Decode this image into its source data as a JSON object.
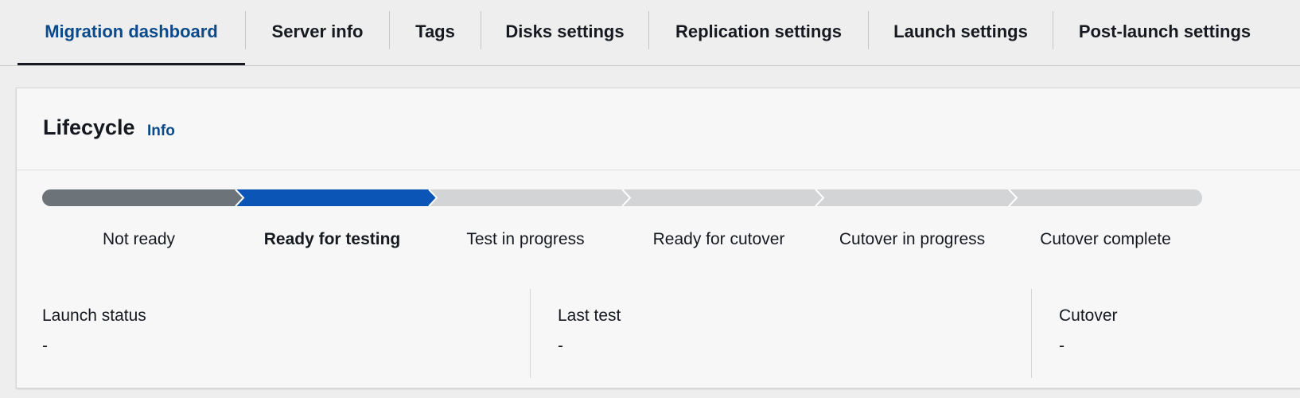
{
  "tabs": [
    {
      "label": "Migration dashboard",
      "active": true
    },
    {
      "label": "Server info",
      "active": false
    },
    {
      "label": "Tags",
      "active": false
    },
    {
      "label": "Disks settings",
      "active": false
    },
    {
      "label": "Replication settings",
      "active": false
    },
    {
      "label": "Launch settings",
      "active": false
    },
    {
      "label": "Post-launch settings",
      "active": false
    }
  ],
  "lifecycle": {
    "title": "Lifecycle",
    "info_label": "Info",
    "current_step_index": 1,
    "steps": [
      {
        "label": "Not ready",
        "state": "completed"
      },
      {
        "label": "Ready for testing",
        "state": "current"
      },
      {
        "label": "Test in progress",
        "state": "pending"
      },
      {
        "label": "Ready for cutover",
        "state": "pending"
      },
      {
        "label": "Cutover in progress",
        "state": "pending"
      },
      {
        "label": "Cutover complete",
        "state": "pending"
      }
    ],
    "colors": {
      "completed": "#6d7479",
      "current": "#0a55b5",
      "pending": "#d2d4d6",
      "chevron": "#ffffff"
    }
  },
  "status": [
    {
      "label": "Launch status",
      "value": "-"
    },
    {
      "label": "Last test",
      "value": "-"
    },
    {
      "label": "Cutover",
      "value": "-"
    }
  ]
}
